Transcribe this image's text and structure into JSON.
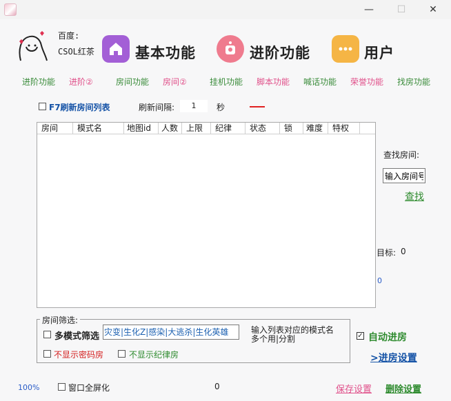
{
  "window": {
    "minimize_glyph": "—",
    "maximize_glyph": "☐",
    "close_glyph": "✕"
  },
  "header": {
    "baidu_label": "百度:",
    "baidu_name": "CSOL红茶",
    "features": [
      {
        "title": "基本功能",
        "icon": "home-icon",
        "color": "#a35fd6"
      },
      {
        "title": "进阶功能",
        "icon": "camera-icon",
        "color": "#ef7b8e"
      },
      {
        "title": "用户",
        "icon": "more-dots-icon",
        "color": "#f5b545"
      }
    ]
  },
  "nav": {
    "items": [
      {
        "label": "进阶功能",
        "color": "green"
      },
      {
        "label": "进阶②",
        "color": "pink"
      },
      {
        "label": "房间功能",
        "color": "green"
      },
      {
        "label": "房间②",
        "color": "pink"
      },
      {
        "label": "挂机功能",
        "color": "green"
      },
      {
        "label": "脚本功能",
        "color": "pink"
      },
      {
        "label": "喊话功能",
        "color": "green"
      },
      {
        "label": "荣誉功能",
        "color": "pink"
      },
      {
        "label": "找房功能",
        "color": "green"
      }
    ]
  },
  "refresh": {
    "label": "F7刷新房间列表",
    "interval_label": "刷新间隔:",
    "interval_value": "1",
    "unit": "秒"
  },
  "table": {
    "columns": [
      "房间",
      "模式名",
      "地图id",
      "人数",
      "上限",
      "纪律",
      "状态",
      "锁",
      "难度",
      "特权"
    ]
  },
  "search": {
    "label": "查找房间:",
    "placeholder": "输入房间号",
    "button": "查找"
  },
  "target": {
    "label": "目标:",
    "value": "0",
    "count": "0"
  },
  "filter": {
    "group_title": "房间筛选:",
    "multi_mode_label": "多模式筛选",
    "mode_value": "灾变|生化Z|感染|大逃杀|生化英雄",
    "hint_line1": "输入列表对应的模式名",
    "hint_line2": "多个用|分割",
    "no_password_label": "不显示密码房",
    "no_law_label": "不显示纪律房"
  },
  "auto": {
    "auto_enter_label": "自动进房",
    "auto_enter_checked": true,
    "enter_settings_label": ">进房设置"
  },
  "bottom": {
    "zoom": "100%",
    "fullscreen_label": "窗口全屏化",
    "counter": "0",
    "save_label": "保存设置",
    "delete_label": "删除设置"
  }
}
